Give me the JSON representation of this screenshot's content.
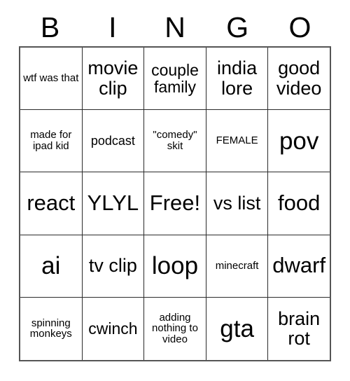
{
  "card": {
    "header_letters": [
      "B",
      "I",
      "N",
      "G",
      "O"
    ],
    "rows": [
      [
        {
          "text": "wtf was that",
          "size": "xs"
        },
        {
          "text": "movie clip",
          "size": "lg"
        },
        {
          "text": "couple family",
          "size": "md"
        },
        {
          "text": "india lore",
          "size": "lg"
        },
        {
          "text": "good video",
          "size": "lg"
        }
      ],
      [
        {
          "text": "made for ipad kid",
          "size": "xs"
        },
        {
          "text": "podcast",
          "size": "sm"
        },
        {
          "text": "\"comedy\" skit",
          "size": "xs"
        },
        {
          "text": "FEMALE",
          "size": "xs"
        },
        {
          "text": "pov",
          "size": "xxl"
        }
      ],
      [
        {
          "text": "react",
          "size": "xl"
        },
        {
          "text": "YLYL",
          "size": "xl"
        },
        {
          "text": "Free!",
          "size": "xl"
        },
        {
          "text": "vs list",
          "size": "lg"
        },
        {
          "text": "food",
          "size": "xl"
        }
      ],
      [
        {
          "text": "ai",
          "size": "xxl"
        },
        {
          "text": "tv clip",
          "size": "lg"
        },
        {
          "text": "loop",
          "size": "xxl"
        },
        {
          "text": "minecraft",
          "size": "xs"
        },
        {
          "text": "dwarf",
          "size": "xl"
        }
      ],
      [
        {
          "text": "spinning monkeys",
          "size": "xs"
        },
        {
          "text": "cwinch",
          "size": "md"
        },
        {
          "text": "adding nothing to video",
          "size": "xs"
        },
        {
          "text": "gta",
          "size": "xxl"
        },
        {
          "text": "brain rot",
          "size": "lg"
        }
      ]
    ]
  }
}
